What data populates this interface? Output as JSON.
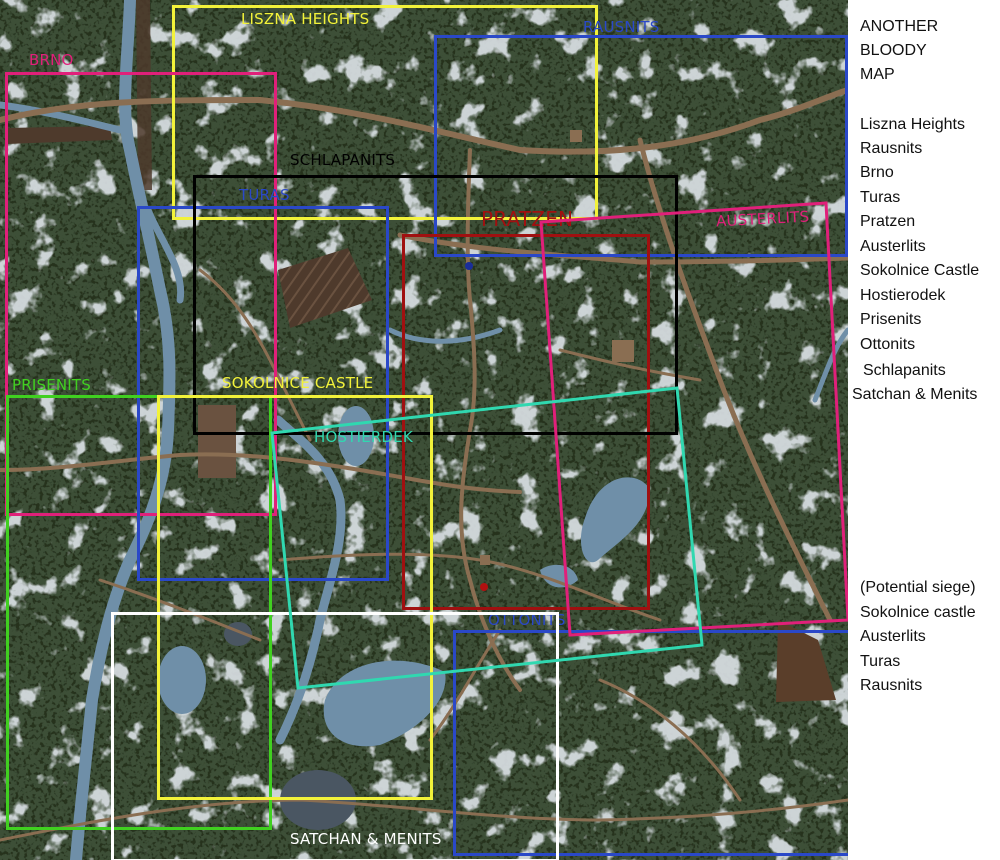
{
  "colors": {
    "forest": "#3d4f37",
    "forest_dark": "#2c3a28",
    "snow": "#dde3e8",
    "water": "#6f8fa8",
    "road": "#8a6e52",
    "field": "#4e3a2c"
  },
  "map": {
    "regions": [
      {
        "id": "liszna",
        "label": "LISZNA HEIGHTS",
        "color": "#f2f23a"
      },
      {
        "id": "rausnits",
        "label": "RAUSNITS",
        "color": "#2a48c8"
      },
      {
        "id": "brno",
        "label": "BRNO",
        "color": "#e0207a"
      },
      {
        "id": "schlapanits",
        "label": "SCHLAPANITS",
        "color": "#000000"
      },
      {
        "id": "turas",
        "label": "TURAS",
        "color": "#2a48c8"
      },
      {
        "id": "pratzen",
        "label": "PRATZEN",
        "color": "#a01010"
      },
      {
        "id": "austerlits",
        "label": "AUSTERLITS",
        "color": "#e0207a"
      },
      {
        "id": "prisenits",
        "label": "PRISENITS",
        "color": "#40d020"
      },
      {
        "id": "sokolnice",
        "label": "SOKOLNICE CASTLE",
        "color": "#f2f23a"
      },
      {
        "id": "hostierodek",
        "label": "HOSTIERDEK",
        "color": "#30d8b0"
      },
      {
        "id": "ottonits",
        "label": "OTTONITS",
        "color": "#2a48c8"
      },
      {
        "id": "satchan",
        "label": "SATCHAN & MENITS",
        "color": "#ffffff"
      }
    ]
  },
  "legend": {
    "title_lines": [
      "ANOTHER",
      "BLOODY",
      "MAP"
    ],
    "map_names": [
      "Liszna Heights",
      "Rausnits",
      "Brno",
      "Turas",
      "Pratzen",
      "Austerlits",
      "Sokolnice Castle",
      "Hostierodek",
      "Prisenits",
      "Ottonits",
      "Schlapanits",
      "Satchan & Menits"
    ],
    "siege_lines": [
      "(Potential siege)",
      "Sokolnice castle",
      "Austerlits",
      "Turas",
      "Rausnits"
    ]
  }
}
